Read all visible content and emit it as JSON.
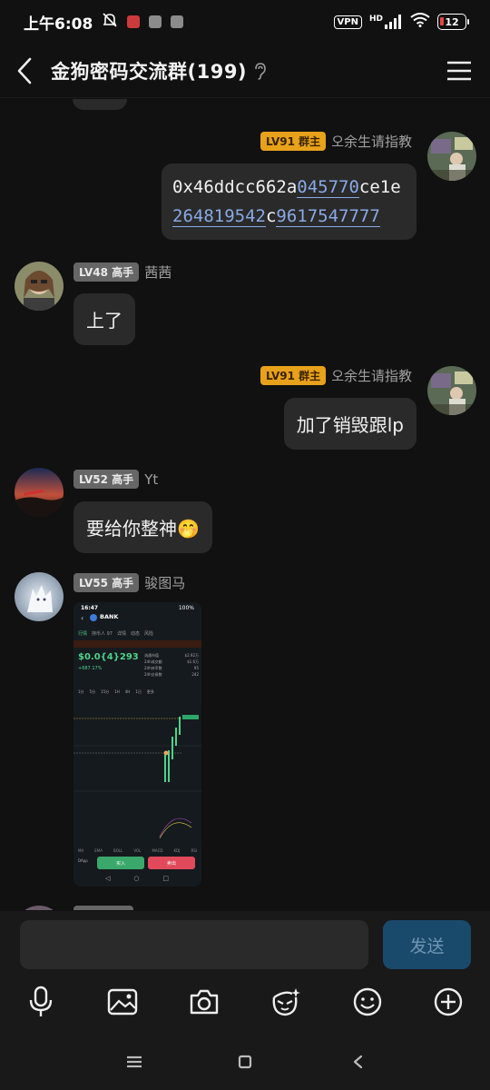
{
  "status_bar": {
    "time": "上午6:08",
    "vpn": "VPN",
    "network": "HD",
    "battery": "12"
  },
  "header": {
    "title": "金狗密码交流群(199)"
  },
  "messages": [
    {
      "sender": "오余生请指教",
      "level": "LV91",
      "role": "群主",
      "side": "right",
      "hash_parts": [
        "0x46ddcc662a",
        "045770",
        "ce1e",
        "264819542",
        "c",
        "9617547777"
      ]
    },
    {
      "sender": "茜茜",
      "level": "LV48",
      "role": "高手",
      "side": "left",
      "text": "上了"
    },
    {
      "sender": "오余生请指教",
      "level": "LV91",
      "role": "群主",
      "side": "right",
      "text": "加了销毁跟lp"
    },
    {
      "sender": "Yt",
      "level": "LV52",
      "role": "高手",
      "side": "left",
      "text": "要给你整神",
      "emoji": "🤭"
    },
    {
      "sender": "骏图马",
      "level": "LV55",
      "role": "高手",
      "side": "left",
      "image": {
        "time": "16:47",
        "battery": "100%",
        "token": "BANK",
        "tabs": [
          "行情",
          "持币人 97",
          "详情",
          "动态",
          "风险"
        ],
        "price": "$0.0{4}293",
        "change": "+687.17%",
        "stats": [
          {
            "label": "流通市值",
            "value": "$2.92万"
          },
          {
            "label": "24h成交额",
            "value": "$1.6万"
          },
          {
            "label": "24h持币数",
            "value": "95"
          },
          {
            "label": "24h交易数",
            "value": "242"
          }
        ],
        "timeframes": [
          "1分",
          "5分",
          "15分",
          "1H",
          "4H",
          "1日",
          "更多"
        ],
        "indicators": [
          "MA",
          "EMA",
          "BOLL",
          "VOL",
          "MACD",
          "KDJ",
          "RSI"
        ],
        "buy_label": "买入",
        "sell_label": "卖出",
        "dapp_label": "DApp"
      }
    }
  ],
  "input": {
    "placeholder": "",
    "send_label": "发送"
  },
  "colors": {
    "background": "#111111",
    "bubble": "#2a2a2a",
    "owner_badge": "#e8a11a",
    "member_badge": "#666666",
    "link": "#8aa9e6",
    "send_button": "#1a4a6b"
  }
}
